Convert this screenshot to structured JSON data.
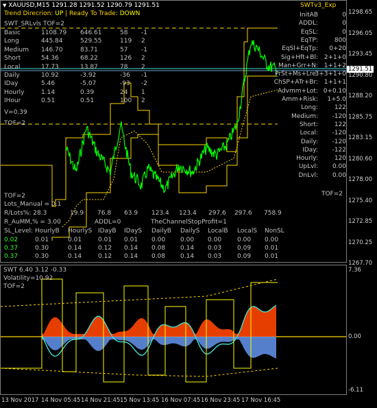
{
  "chart_header": "XAUUSD,M15  1291.28 1291.52 1290.79 1291.51",
  "ea_label": "SWTv3_Exp",
  "trend_line": {
    "prefix": "Trend Direcrion:",
    "trend": "UP",
    "sep": "|",
    "ready": "Ready To Trade:",
    "ready_value": "DOWN"
  },
  "srlvls": "SWT_SRLvls  TOF=2",
  "levels_table": [
    {
      "name": "Basic",
      "a": "1108.79",
      "b": "646.61",
      "c": "58",
      "d": "-1"
    },
    {
      "name": "Long",
      "a": "445.84",
      "b": "529.55",
      "c": "119",
      "d": "2"
    },
    {
      "name": "Medium",
      "a": "146.70",
      "b": "83.71",
      "c": "57",
      "d": "-1"
    },
    {
      "name": "Short",
      "a": "54.36",
      "b": "68.22",
      "c": "126",
      "d": "2"
    },
    {
      "name": "Local",
      "a": "17.73",
      "b": "13.87",
      "c": "78",
      "d": "2"
    },
    {
      "name": "Daily",
      "a": "10.92",
      "b": "-3.92",
      "c": "-36",
      "d": "-1"
    },
    {
      "name": "IDay",
      "a": "5.46",
      "b": "-5.07",
      "c": "-93",
      "d": "-2"
    },
    {
      "name": "Hourly",
      "a": "1.14",
      "b": "0.39",
      "c": "24",
      "d": "1"
    },
    {
      "name": "IHour",
      "a": "0.51",
      "b": "0.51",
      "c": "100",
      "d": "2"
    }
  ],
  "v_label": "V=0.39",
  "tof_label_1": "TOF=2",
  "tof_label_2": "TOF=2",
  "lots_manual": "Lots_Manual = 0.1",
  "rlots": [
    "R/Lots%: 28.3",
    "19.9",
    "76.8",
    "63.9",
    "123.4",
    "123.4",
    "297.6",
    "297.6",
    "758.9"
  ],
  "raumm": {
    "left": "R_AuMM,% = 3.00",
    "mid": "ADDL=0",
    "right": "TheChannelStopProfit=1"
  },
  "sl_headers": [
    "SL_Level:",
    "HourlyB",
    "HourlyS",
    "IDayB",
    "IDayS",
    "DailyB",
    "DailyS",
    "LocalB",
    "LocalS",
    "NonSL"
  ],
  "sl_rows": [
    [
      "0.02",
      "0.01",
      "0.01",
      "0.01",
      "0.01",
      "0.00",
      "0.00",
      "0.00",
      "0.00",
      "0.00"
    ],
    [
      "0.37",
      "0.30",
      "0.14",
      "0.12",
      "0.14",
      "0.08",
      "0.14",
      "0.03",
      "0.09",
      "0.01"
    ],
    [
      "0.37",
      "0.30",
      "0.14",
      "0.12",
      "0.14",
      "0.08",
      "0.14",
      "0.03",
      "0.09",
      "0.01"
    ]
  ],
  "right_info": [
    {
      "label": "InitAB",
      "value": "0"
    },
    {
      "label": "ADDL:",
      "value": "0"
    },
    {
      "label": "EqSL:",
      "value": "0"
    },
    {
      "label": "EqTP:",
      "value": "800"
    },
    {
      "label": "EqSl+EqTp:",
      "value": "0+20"
    },
    {
      "label": "Sig+Hft+Bl:",
      "value": "2+1+0"
    },
    {
      "label": "Man+Grr+N:",
      "value": "1+1+2"
    },
    {
      "label": "PrSt+Ms+Lre:",
      "value": "3+3+1+0"
    },
    {
      "label": "ChSP+ATr+Br:",
      "value": "1+1+1"
    },
    {
      "label": "Advmm+Lot:",
      "value": "0+0.10"
    },
    {
      "label": "Amm+Risk:",
      "value": "1+5.0"
    },
    {
      "label": "Long:",
      "value": "122"
    },
    {
      "label": "Medium:",
      "value": "-120"
    },
    {
      "label": "Short:",
      "value": "122"
    },
    {
      "label": "Local:",
      "value": "-120"
    },
    {
      "label": "Daily:",
      "value": "-120"
    },
    {
      "label": "IDay:",
      "value": "-122"
    },
    {
      "label": "Hourly:",
      "value": "120"
    },
    {
      "label": "UpLvl:",
      "value": "0.00"
    },
    {
      "label": "DnLvl:",
      "value": "0.00"
    }
  ],
  "tof_right": "TOF=2",
  "price_axis": [
    "1298.65",
    "1296.05",
    "1293.45",
    "1290.80",
    "1288.20",
    "1285.75",
    "1283.15",
    "1280.60",
    "1278.00",
    "1275.40",
    "1272.85",
    "1270.25",
    "1267.70"
  ],
  "current_price": "1291.51",
  "sub_title": "SWT 6.40 3.12 -0.33",
  "volatility": "Volatility=10.92",
  "sub_tof": "TOF=2",
  "sub_axis": [
    "7.36",
    "0.00",
    "-6.11"
  ],
  "dates": [
    "13 Nov 2017",
    "14 Nov 05:45",
    "14 Nov 21:45",
    "15 Nov 13:45",
    "16 Nov 07:45",
    "16 Nov 23:45",
    "17 Nov 16:45"
  ],
  "colors": {
    "background": "#000000",
    "candles": "#00ff00",
    "levels": "#ffd700",
    "text": "#ffffff",
    "accent_red": "#ff4500",
    "accent_cyan": "#40e0d0",
    "accent_blue": "#6495ed"
  }
}
